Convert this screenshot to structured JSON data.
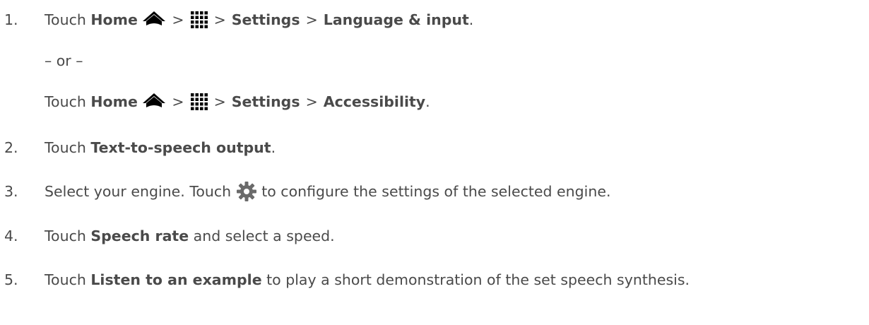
{
  "steps": [
    {
      "num": "1.",
      "line_a": {
        "touch": "Touch",
        "home": "Home",
        "sep1": ">",
        "sep2": ">",
        "settings": "Settings",
        "sep3": ">",
        "target": "Language & input",
        "end": "."
      },
      "or": "– or –",
      "line_b": {
        "touch": "Touch",
        "home": "Home",
        "sep1": ">",
        "sep2": ">",
        "settings": "Settings",
        "sep3": ">",
        "target": "Accessibility",
        "end": "."
      }
    },
    {
      "num": "2.",
      "pre": "Touch ",
      "bold": "Text-to-speech output",
      "post": "."
    },
    {
      "num": "3.",
      "pre": "Select your engine. Touch ",
      "icon": "gear-icon",
      "post": " to configure the settings of the selected engine."
    },
    {
      "num": "4.",
      "pre": "Touch ",
      "bold": "Speech rate",
      "post": " and select a speed."
    },
    {
      "num": "5.",
      "pre": "Touch ",
      "bold": "Listen to an example",
      "post": " to play a short demonstration of the set speech synthesis."
    }
  ],
  "icons": {
    "home": "home-icon",
    "apps": "apps-grid-icon",
    "gear": "gear-icon"
  },
  "colors": {
    "text": "#4a4a4a",
    "icon": "#000000"
  }
}
